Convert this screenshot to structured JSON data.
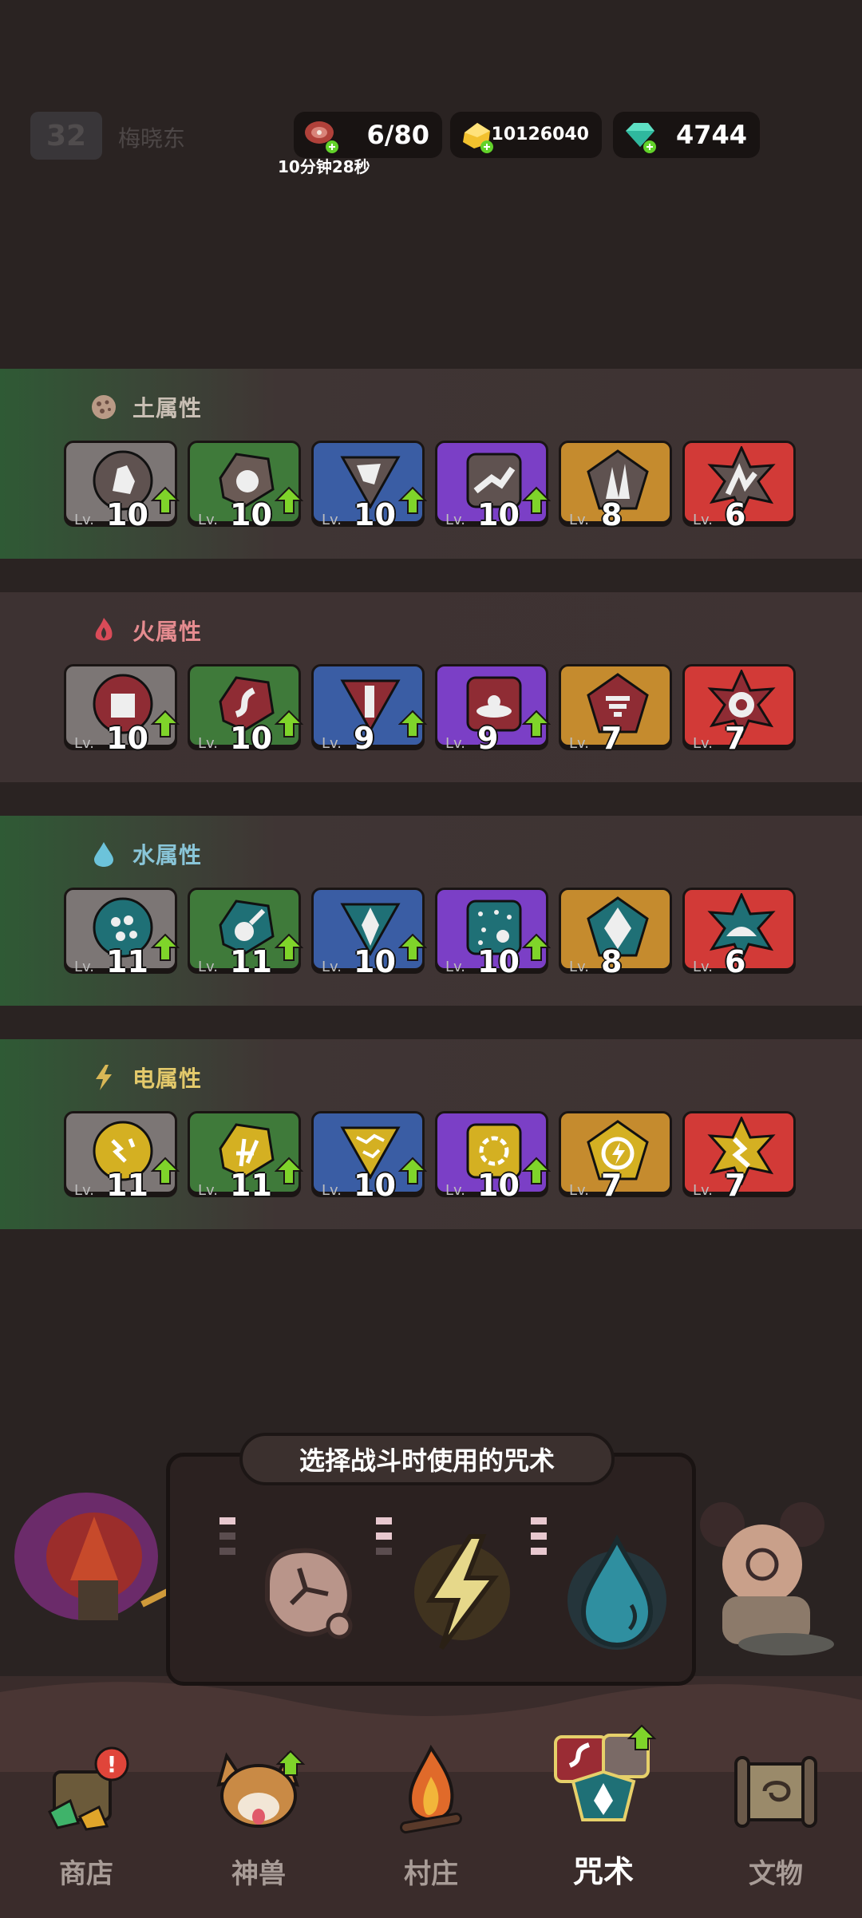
{
  "player": {
    "level": "32",
    "name": "梅晓东"
  },
  "resources": {
    "energy": {
      "icon": "meat-icon",
      "value": "6/80",
      "timer": "10分钟28秒"
    },
    "gold": {
      "icon": "gold-icon",
      "value": "10126040"
    },
    "gems": {
      "icon": "gem-icon",
      "value": "4744"
    }
  },
  "level_prefix": "Lv.",
  "sections": [
    {
      "title": "土属性",
      "icon": "earth-element-icon",
      "levels": [
        "10",
        "10",
        "10",
        "10",
        "8",
        "6"
      ],
      "upgradable": [
        true,
        true,
        true,
        true,
        false,
        false
      ]
    },
    {
      "title": "火属性",
      "icon": "fire-element-icon",
      "levels": [
        "10",
        "10",
        "9",
        "9",
        "7",
        "7"
      ],
      "upgradable": [
        true,
        true,
        true,
        true,
        false,
        false
      ]
    },
    {
      "title": "水属性",
      "icon": "water-element-icon",
      "levels": [
        "11",
        "11",
        "10",
        "10",
        "8",
        "6"
      ],
      "upgradable": [
        true,
        true,
        true,
        true,
        false,
        false
      ]
    },
    {
      "title": "电属性",
      "icon": "lightning-element-icon",
      "levels": [
        "11",
        "11",
        "10",
        "10",
        "7",
        "7"
      ],
      "upgradable": [
        true,
        true,
        true,
        true,
        false,
        false
      ]
    }
  ],
  "loadout": {
    "title": "选择战斗时使用的咒术",
    "slots": [
      {
        "element": "earth",
        "icon": "rock-icon",
        "dots_on": 1
      },
      {
        "element": "lightning",
        "icon": "lightning-bolt-icon",
        "dots_on": 2
      },
      {
        "element": "water",
        "icon": "water-drop-icon",
        "dots_on": 3
      }
    ]
  },
  "nav": [
    {
      "label": "商店",
      "icon": "shop-icon",
      "badge": "!"
    },
    {
      "label": "神兽",
      "icon": "beast-icon"
    },
    {
      "label": "村庄",
      "icon": "campfire-icon"
    },
    {
      "label": "咒术",
      "icon": "spells-icon",
      "active": true
    },
    {
      "label": "文物",
      "icon": "scroll-icon"
    }
  ],
  "colors": {
    "gray": "#7c7675",
    "green": "#3f7a3a",
    "blue": "#3a5da4",
    "purple": "#7b3fc6",
    "orange": "#c58b2e",
    "red": "#d23a37",
    "upgrade": "#7fd42a"
  }
}
